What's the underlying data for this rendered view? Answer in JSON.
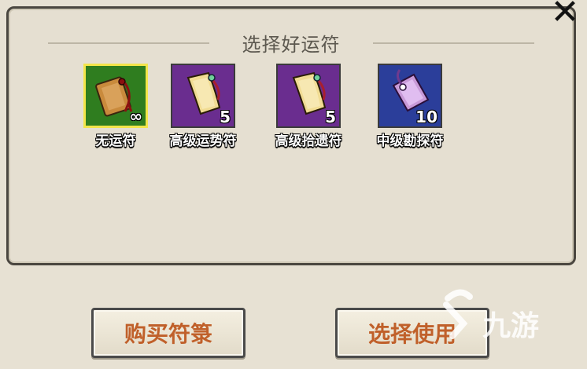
{
  "dialog": {
    "title": "选择好运符",
    "close_glyph": "✕"
  },
  "items": [
    {
      "name": "无运符",
      "count": "∞",
      "bg": "#2f7d1f",
      "selected": true,
      "icon": "talisman-scroll-icon"
    },
    {
      "name": "高级运势符",
      "count": "5",
      "bg": "#6a2d8f",
      "selected": false,
      "icon": "fortune-talisman-icon"
    },
    {
      "name": "高级拾遗符",
      "count": "5",
      "bg": "#6a2d8f",
      "selected": false,
      "icon": "pickup-talisman-icon"
    },
    {
      "name": "中级勘探符",
      "count": "10",
      "bg": "#2b3e9a",
      "selected": false,
      "icon": "explore-talisman-icon"
    }
  ],
  "buttons": {
    "buy_label": "购买符箓",
    "choose_label": "选择使用"
  },
  "watermark": {
    "text": "九游",
    "icon": "nine-game-logo-icon"
  },
  "colors": {
    "background": "#e7e1d3",
    "button_text": "#c0602a",
    "selected_border": "#f2e54a"
  }
}
